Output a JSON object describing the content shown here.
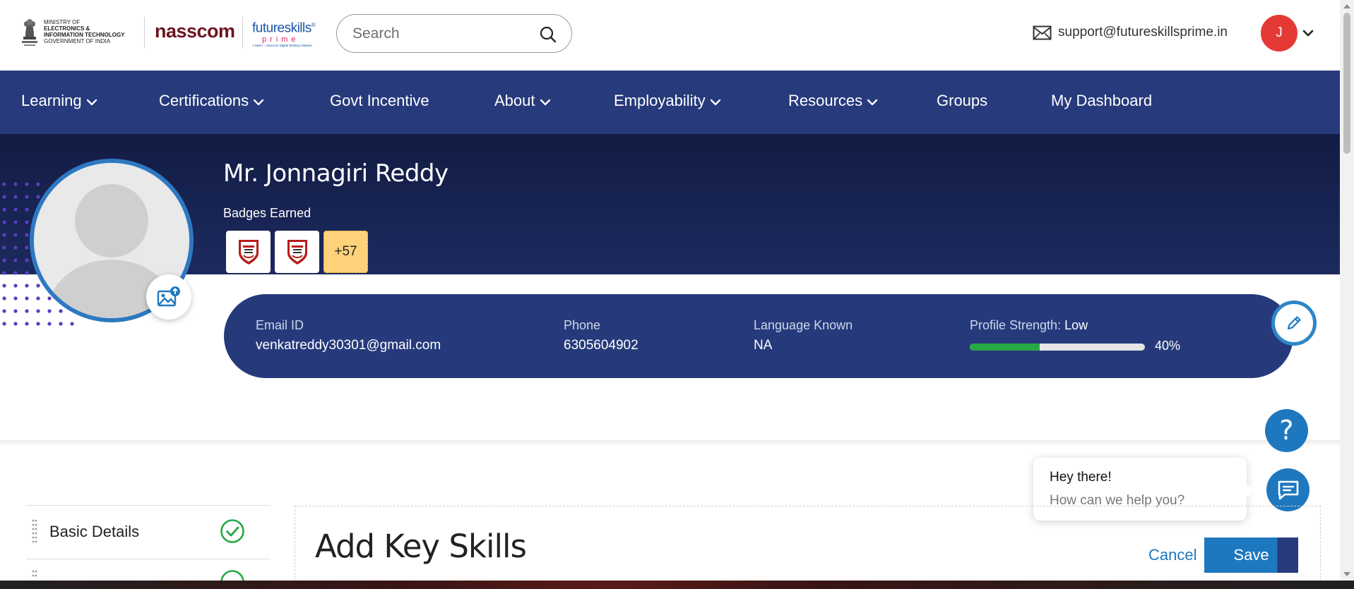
{
  "header": {
    "meity": {
      "line1": "Ministry of",
      "line2": "Electronics &",
      "line3": "Information Technology",
      "line4": "Government of India"
    },
    "nasscom": "nasscom",
    "fsp": {
      "top": "futureskills",
      "mid": "prime",
      "tagline": "A MeitY - nasscom Digital Skilling Initiative"
    },
    "search": {
      "placeholder": "Search",
      "value": ""
    },
    "support_email": "support@futureskillsprime.in",
    "user_initial": "J"
  },
  "nav": {
    "items": [
      {
        "label": "Learning",
        "has_dropdown": true
      },
      {
        "label": "Certifications",
        "has_dropdown": true
      },
      {
        "label": "Govt Incentive",
        "has_dropdown": false
      },
      {
        "label": "About",
        "has_dropdown": true
      },
      {
        "label": "Employability",
        "has_dropdown": true
      },
      {
        "label": "Resources",
        "has_dropdown": true
      },
      {
        "label": "Groups",
        "has_dropdown": false
      },
      {
        "label": "My Dashboard",
        "has_dropdown": false
      }
    ]
  },
  "profile": {
    "name": "Mr. Jonnagiri Reddy",
    "badges_label": "Badges Earned",
    "badges_more": "+57",
    "info": {
      "email_label": "Email ID",
      "email_value": "venkatreddy30301@gmail.com",
      "phone_label": "Phone",
      "phone_value": "6305604902",
      "language_label": "Language Known",
      "language_value": "NA",
      "strength_label": "Profile Strength:",
      "strength_value": "Low",
      "strength_percent_text": "40%",
      "strength_fraction": 0.4
    }
  },
  "chat": {
    "title": "Hey there!",
    "subtitle": "How can we help you?",
    "help_symbol": "?"
  },
  "sidebar": {
    "items": [
      {
        "label": "Basic Details",
        "completed": true
      }
    ]
  },
  "main": {
    "section_title": "Add Key Skills",
    "cancel_label": "Cancel",
    "save_label": "Save"
  },
  "colors": {
    "nav_bg": "#273a7b",
    "banner_bg": "#121c44",
    "accent": "#1e78bf",
    "success": "#27a844",
    "avatar_red": "#e53935",
    "badge_more_bg": "#ffd27a"
  }
}
